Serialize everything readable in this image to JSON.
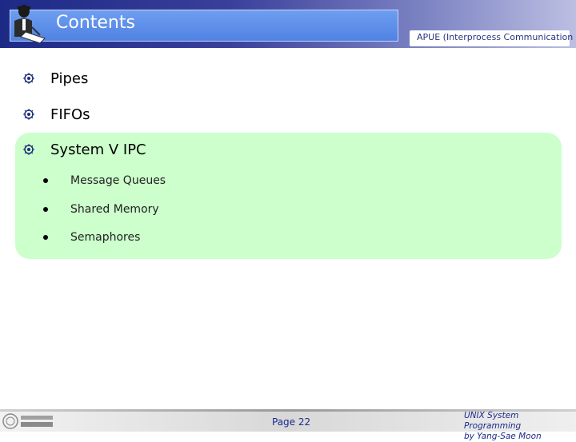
{
  "header": {
    "title": "Contents",
    "subtitle": "APUE (Interprocess Communication"
  },
  "bullets": [
    {
      "label": "Pipes"
    },
    {
      "label": "FIFOs"
    },
    {
      "label": "System V IPC"
    }
  ],
  "sub_bullets": [
    {
      "label": "Message Queues"
    },
    {
      "label": "Shared Memory"
    },
    {
      "label": "Semaphores"
    }
  ],
  "footer": {
    "page": "Page 22",
    "credit_line1": "UNIX System Programming",
    "credit_line2": "by Yang-Sae Moon"
  },
  "colors": {
    "header_dark": "#1c2a86",
    "title_box": "#4f82e3",
    "panel": "#ccffcc",
    "footer_text": "#1a2a8a"
  },
  "icons": {
    "logo": "person-reading-icon",
    "bullet": "ornament-bullet-icon",
    "footer_logo": "university-seal-icon"
  }
}
